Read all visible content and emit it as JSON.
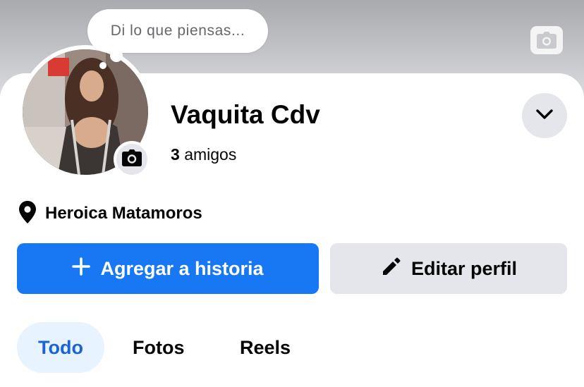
{
  "bubble": {
    "text": "Di lo que piensas..."
  },
  "profile": {
    "name": "Vaquita Cdv",
    "friends_count": "3",
    "friends_label": "amigos",
    "location": "Heroica Matamoros"
  },
  "actions": {
    "add_story": "Agregar a historia",
    "edit_profile": "Editar perfil"
  },
  "tabs": [
    {
      "label": "Todo",
      "active": true
    },
    {
      "label": "Fotos",
      "active": false
    },
    {
      "label": "Reels",
      "active": false
    }
  ],
  "icons": {
    "cover_camera": "camera-icon",
    "avatar_camera": "camera-icon",
    "more": "chevron-down-icon",
    "location": "location-pin-icon",
    "add": "plus-icon",
    "edit": "pencil-icon"
  },
  "colors": {
    "primary": "#1877f2",
    "secondary_button": "#e4e6eb",
    "active_tab_bg": "#e7f3ff",
    "active_tab_text": "#1b64d6",
    "text": "#050505",
    "muted": "#65676b"
  }
}
